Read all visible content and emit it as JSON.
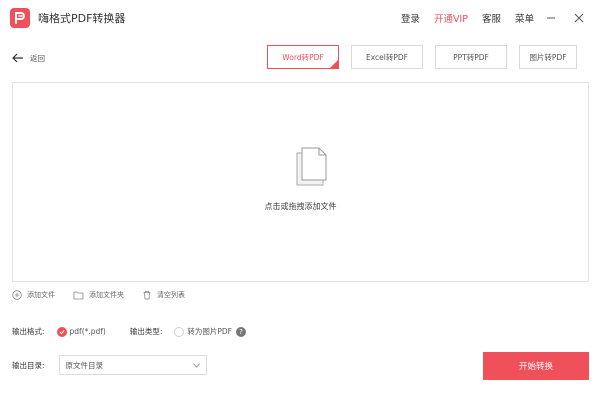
{
  "app": {
    "title": "嗨格式PDF转换器"
  },
  "top_menu": {
    "login": "登录",
    "vip": "开通VIP",
    "service": "客服",
    "menu": "菜单"
  },
  "toolbar": {
    "back_label": "返回"
  },
  "tabs": [
    {
      "label": "Word转PDF",
      "active": true
    },
    {
      "label": "Excel转PDF",
      "active": false
    },
    {
      "label": "PPT转PDF",
      "active": false
    },
    {
      "label": "图片转PDF",
      "active": false
    }
  ],
  "dropzone": {
    "text": "点击或拖拽添加文件"
  },
  "file_actions": {
    "add_file": "添加文件",
    "add_folder": "添加文件夹",
    "clear_list": "清空列表"
  },
  "output": {
    "format_label": "输出格式:",
    "format_option": "pdf(*.pdf)",
    "type_label": "输出类型:",
    "type_option": "转为图片PDF",
    "help": "?",
    "dir_label": "输出目录:",
    "dir_value": "原文件目录"
  },
  "start_button": "开始转换",
  "colors": {
    "accent": "#f0505a"
  }
}
